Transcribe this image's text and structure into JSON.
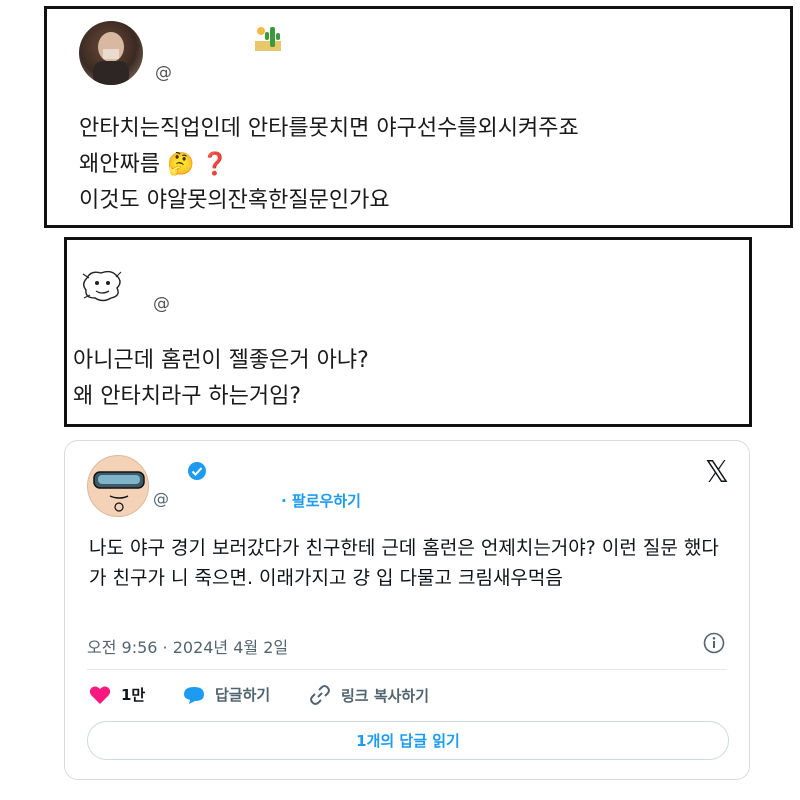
{
  "post1": {
    "handle": "@",
    "lines": [
      "안타치는직업인데 안타를못치면 야구선수를외시켜주죠",
      "왜안짜름",
      "이것도 야알못의잔혹한질문인가요"
    ],
    "emoji_think": "🤔",
    "emoji_question": "❓"
  },
  "post2": {
    "handle": "@",
    "lines": [
      "아니근데 홈런이 젤좋은거 아냐?",
      "왜 안타치라구 하는거임?"
    ]
  },
  "tweet": {
    "handle": "@",
    "follow_label": "· 팔로우하기",
    "text": "나도 야구 경기 보러갔다가 친구한테 근데 홈런은 언제치는거야? 이런 질문 했다가 친구가 니 죽으면. 이래가지고 걍 입 다물고 크림새우먹음",
    "meta": "오전 9:56 · 2024년 4월 2일",
    "likes": "1만",
    "reply_label": "답글하기",
    "copy_link_label": "링크 복사하기",
    "read_replies_label": "1개의 답글 읽기",
    "colors": {
      "like": "#f91880",
      "accent": "#1d9bf0",
      "muted": "#536471"
    },
    "icons": [
      "verified-badge-icon",
      "x-logo-icon",
      "info-icon",
      "heart-icon",
      "reply-bubble-icon",
      "link-icon"
    ]
  }
}
